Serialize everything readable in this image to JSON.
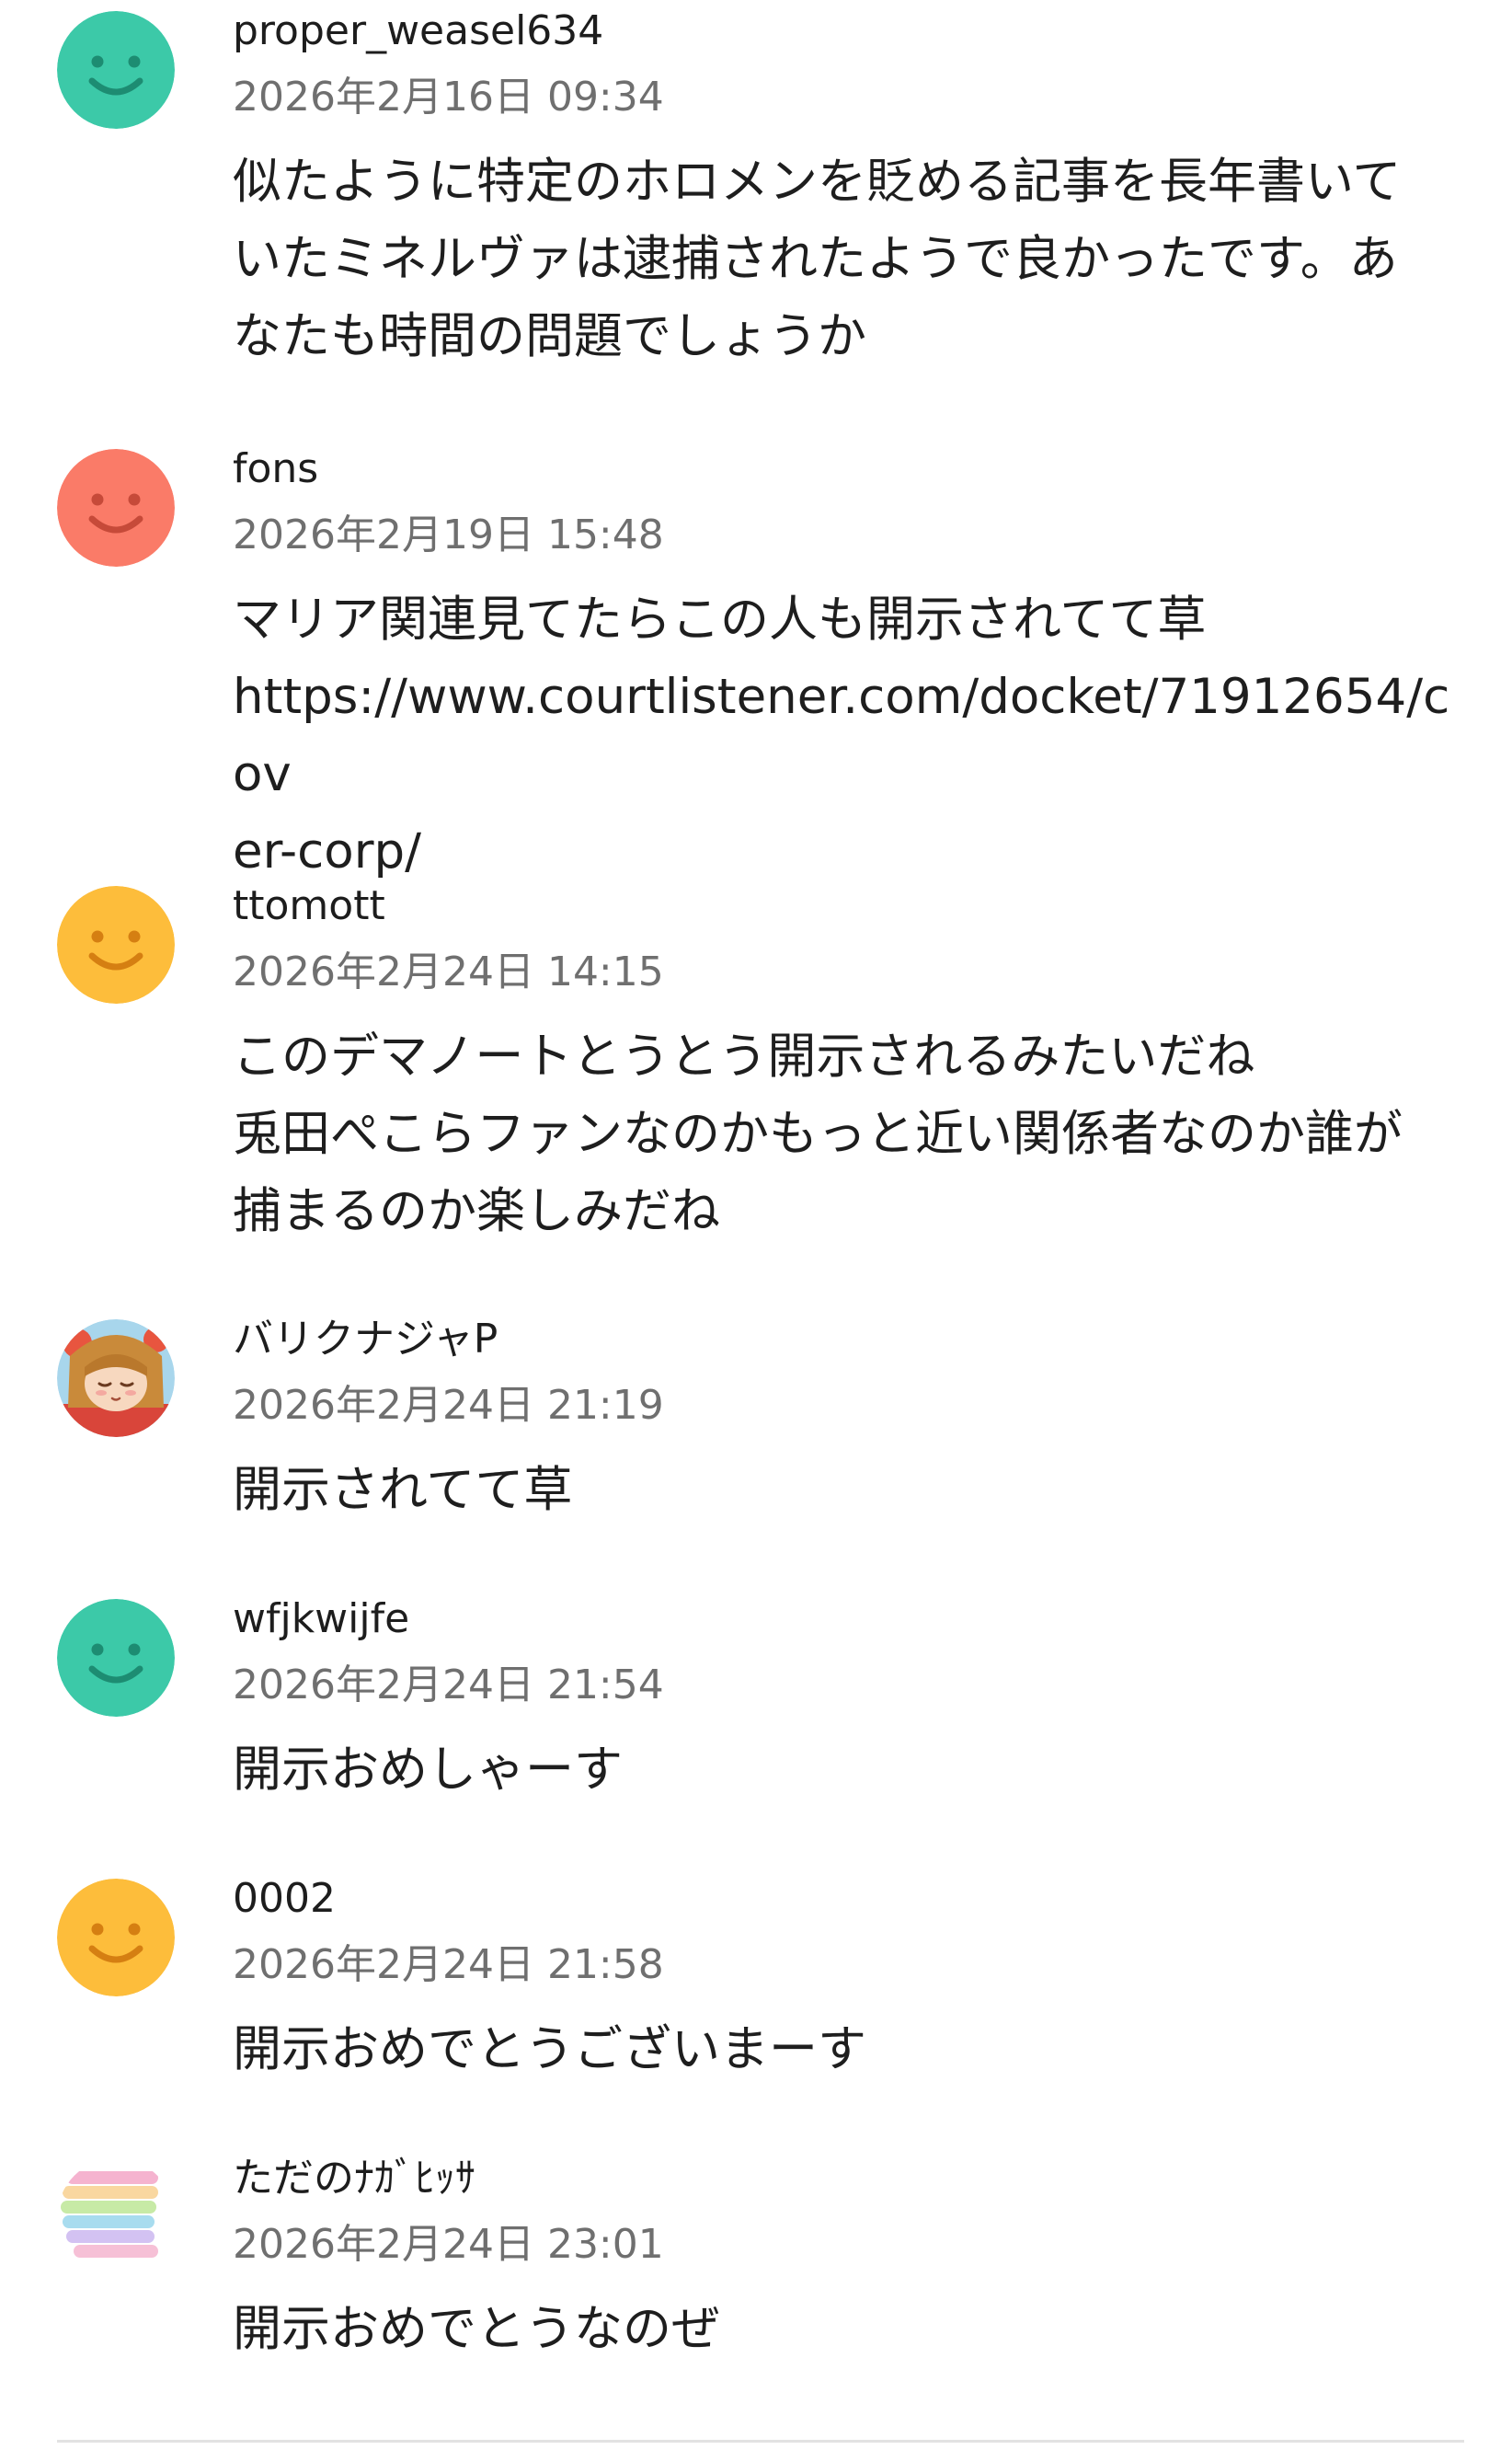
{
  "comments": [
    {
      "user": "proper_weasel634",
      "time": "2026年2月16日 09:34",
      "body": "似たように特定のホロメンを貶める記事を長年書いて\nいたミネルヴァは逮捕されたようで良かったです。あ\nなたも時間の問題でしょうか",
      "avatar": {
        "type": "smiley",
        "color": "#3cc9a8"
      }
    },
    {
      "user": "fons",
      "time": "2026年2月19日 15:48",
      "body": "マリア関連見てたらこの人も開示されてて草\nhttps://www.courtlistener.com/docket/71912654/cov\ner-corp/",
      "avatar": {
        "type": "smiley",
        "color": "#fa7b68"
      }
    },
    {
      "user": "ttomott",
      "time": "2026年2月24日 14:15",
      "body": "このデマノートとうとう開示されるみたいだね\n兎田ぺこらファンなのかもっと近い関係者なのか誰が\n捕まるのか楽しみだね",
      "avatar": {
        "type": "smiley",
        "color": "#fdbd3b"
      }
    },
    {
      "user": "バリクナジャP",
      "time": "2026年2月24日 21:19",
      "body": "開示されてて草",
      "avatar": {
        "type": "illustration",
        "color": "#e65a3f"
      }
    },
    {
      "user": "wfjkwijfe",
      "time": "2026年2月24日 21:54",
      "body": "開示おめしゃーす",
      "avatar": {
        "type": "smiley",
        "color": "#3cc9a8"
      }
    },
    {
      "user": "0002",
      "time": "2026年2月24日 21:58",
      "body": "開示おめでとうございまーす",
      "avatar": {
        "type": "smiley",
        "color": "#fdbd3b"
      }
    },
    {
      "user": "ただのﾅｶﾞﾋｯｻ",
      "time": "2026年2月24日 23:01",
      "body": "開示おめでとうなのぜ",
      "avatar": {
        "type": "stripes",
        "color": "#f4a7c3"
      }
    }
  ]
}
